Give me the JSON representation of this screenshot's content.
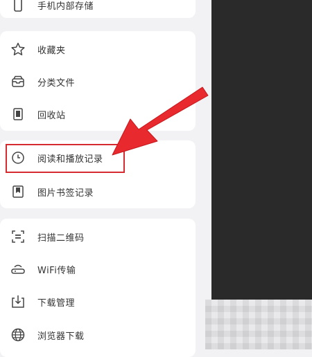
{
  "storage": {
    "label": "手机内部存储",
    "icon": "phone-icon"
  },
  "section_one": [
    {
      "label": "收藏夹",
      "icon": "star-icon"
    },
    {
      "label": "分类文件",
      "icon": "folder-category-icon"
    },
    {
      "label": "回收站",
      "icon": "trash-icon"
    }
  ],
  "section_two": [
    {
      "label": "阅读和播放记录",
      "icon": "clock-icon"
    },
    {
      "label": "图片书签记录",
      "icon": "bookmark-icon"
    }
  ],
  "section_three": [
    {
      "label": "扫描二维码",
      "icon": "scan-qr-icon"
    },
    {
      "label": "WiFi传输",
      "icon": "wifi-transfer-icon"
    },
    {
      "label": "下载管理",
      "icon": "download-icon"
    },
    {
      "label": "浏览器下载",
      "icon": "globe-icon"
    }
  ],
  "colors": {
    "highlight": "#d52a2f",
    "arrow": "#e8292e",
    "panel": "#ffffff",
    "background": "#f2f2f4",
    "dark_area": "#2a2a2a"
  }
}
